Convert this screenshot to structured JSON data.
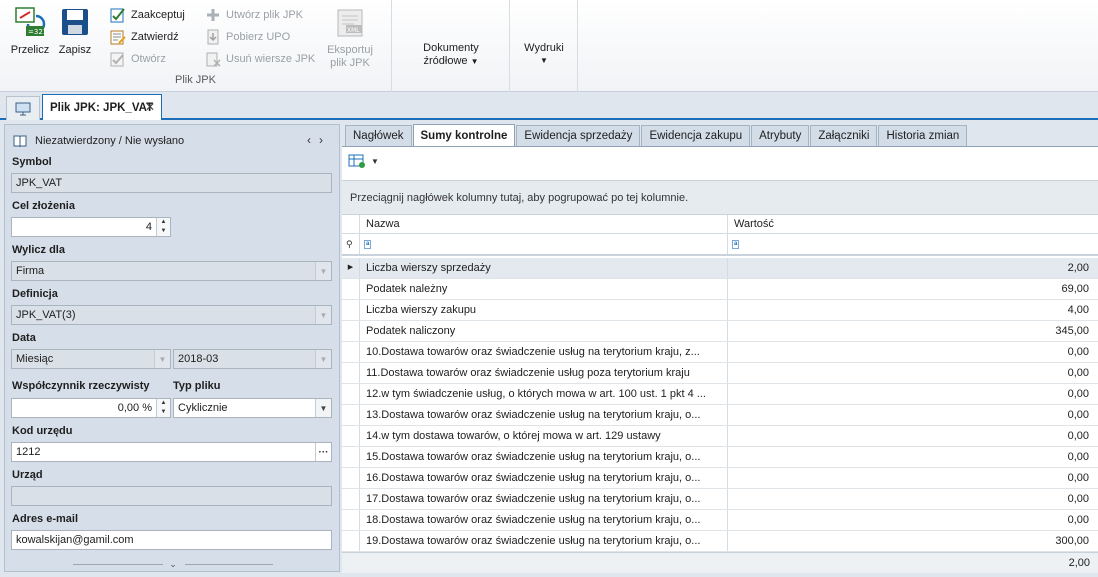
{
  "ribbon": {
    "przelicz": "Przelicz",
    "zapisz": "Zapisz",
    "zaakceptuj": "Zaakceptuj",
    "zatwierdz": "Zatwierdź",
    "otworz": "Otwórz",
    "utworz_plik": "Utwórz plik JPK",
    "pobierz_upo": "Pobierz UPO",
    "usun_wiersze": "Usuń wiersze JPK",
    "eksportuj_1": "Eksportuj",
    "eksportuj_2": "plik JPK",
    "group_label": "Plik JPK",
    "dokumenty_1": "Dokumenty",
    "dokumenty_2": "źródłowe",
    "wydruki": "Wydruki"
  },
  "doc_tab": {
    "title": "Plik JPK: JPK_VAT"
  },
  "left": {
    "status": "Niezatwierdzony / Nie wysłano",
    "symbol_label": "Symbol",
    "symbol_value": "JPK_VAT",
    "cel_label": "Cel złożenia",
    "cel_value": "4",
    "wylicz_label": "Wylicz dla",
    "wylicz_value": "Firma",
    "definicja_label": "Definicja",
    "definicja_value": "JPK_VAT(3)",
    "data_label": "Data",
    "okres_value": "Miesiąc",
    "data_value": "2018-03",
    "wspolczynnik_label": "Współczynnik rzeczywisty",
    "wspolczynnik_value": "0,00 %",
    "typ_label": "Typ pliku",
    "typ_value": "Cyklicznie",
    "kod_label": "Kod urzędu",
    "kod_value": "1212",
    "urzad_label": "Urząd",
    "urzad_value": "",
    "email_label": "Adres e-mail",
    "email_value": "kowalskijan@gamil.com"
  },
  "tabs": [
    "Nagłówek",
    "Sumy kontrolne",
    "Ewidencja sprzedaży",
    "Ewidencja zakupu",
    "Atrybuty",
    "Załączniki",
    "Historia zmian"
  ],
  "grid": {
    "group_hint": "Przeciągnij nagłówek kolumny tutaj, aby pogrupować po tej kolumnie.",
    "col_name": "Nazwa",
    "col_value": "Wartość",
    "rows": [
      {
        "name": "Liczba wierszy sprzedaży",
        "value": "2,00"
      },
      {
        "name": "Podatek należny",
        "value": "69,00"
      },
      {
        "name": "Liczba wierszy zakupu",
        "value": "4,00"
      },
      {
        "name": "Podatek naliczony",
        "value": "345,00"
      },
      {
        "name": "10.Dostawa towarów oraz świadczenie usług na terytorium kraju, z...",
        "value": "0,00"
      },
      {
        "name": "11.Dostawa towarów oraz świadczenie usług poza terytorium kraju",
        "value": "0,00"
      },
      {
        "name": "12.w tym świadczenie usług, o których mowa w art. 100 ust. 1 pkt 4 ...",
        "value": "0,00"
      },
      {
        "name": "13.Dostawa towarów oraz świadczenie usług na terytorium kraju, o...",
        "value": "0,00"
      },
      {
        "name": "14.w tym dostawa towarów, o której mowa w art. 129 ustawy",
        "value": "0,00"
      },
      {
        "name": "15.Dostawa towarów oraz świadczenie usług na terytorium kraju, o...",
        "value": "0,00"
      },
      {
        "name": "16.Dostawa towarów oraz świadczenie usług na terytorium kraju, o...",
        "value": "0,00"
      },
      {
        "name": "17.Dostawa towarów oraz świadczenie usług na terytorium kraju, o...",
        "value": "0,00"
      },
      {
        "name": "18.Dostawa towarów oraz świadczenie usług na terytorium kraju, o...",
        "value": "0,00"
      },
      {
        "name": "19.Dostawa towarów oraz świadczenie usług na terytorium kraju, o...",
        "value": "300,00"
      }
    ],
    "footer_sum": "2,00"
  }
}
